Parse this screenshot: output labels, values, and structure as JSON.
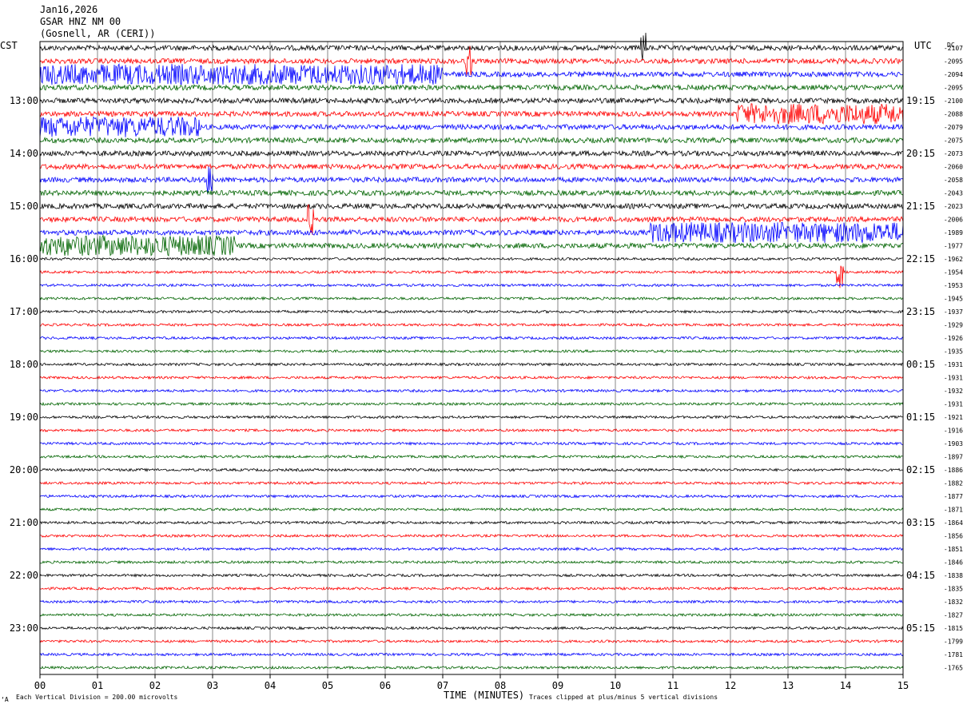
{
  "header": {
    "date": "Jan16,2026",
    "station": "GSAR HNZ NM 00",
    "location": "(Gosnell, AR (CERI))"
  },
  "left_zone": "CST",
  "right_zone": "UTC",
  "dc_label": "DC",
  "footer": {
    "scale_note": "Each Vertical Division =  200.00 microvolts",
    "clip_note": "Traces clipped at plus/minus 5 vertical divisions",
    "corner_mark": "‘A"
  },
  "chart_data": {
    "type": "line",
    "title": "",
    "xlabel": "TIME (MINUTES)",
    "xlim": [
      0,
      15
    ],
    "x_ticks": [
      "00",
      "01",
      "02",
      "03",
      "04",
      "05",
      "06",
      "07",
      "08",
      "09",
      "10",
      "11",
      "12",
      "13",
      "14",
      "15"
    ],
    "trace_colors": [
      "#000000",
      "#ff0000",
      "#0000ff",
      "#006400"
    ],
    "left_hour_labels": [
      "13:00",
      "14:00",
      "15:00",
      "16:00",
      "17:00",
      "18:00",
      "19:00",
      "20:00",
      "21:00",
      "22:00",
      "23:00"
    ],
    "right_hour_labels": [
      "19:15",
      "20:15",
      "21:15",
      "22:15",
      "23:15",
      "00:15",
      "01:15",
      "02:15",
      "03:15",
      "04:15",
      "05:15"
    ],
    "dc_offsets": [
      -2107,
      -2095,
      -2094,
      -2095,
      -2100,
      -2088,
      -2079,
      -2075,
      -2073,
      -2060,
      -2058,
      -2043,
      -2023,
      -2006,
      -1989,
      -1977,
      -1962,
      -1954,
      -1953,
      -1945,
      -1937,
      -1929,
      -1926,
      -1935,
      -1931,
      -1931,
      -1932,
      -1931,
      -1921,
      -1916,
      -1903,
      -1897,
      -1886,
      -1882,
      -1877,
      -1871,
      -1864,
      -1856,
      -1851,
      -1846,
      -1838,
      -1835,
      -1832,
      -1827,
      -1815,
      -1799,
      -1781,
      -1765
    ],
    "noisy_segments": [
      {
        "trace": 2,
        "start_min": 0.0,
        "end_min": 7.0,
        "level": "high"
      },
      {
        "trace": 5,
        "start_min": 12.1,
        "end_min": 15.0,
        "level": "high"
      },
      {
        "trace": 6,
        "start_min": 0.0,
        "end_min": 2.8,
        "level": "high"
      },
      {
        "trace": 14,
        "start_min": 10.6,
        "end_min": 15.0,
        "level": "high"
      },
      {
        "trace": 15,
        "start_min": 0.0,
        "end_min": 3.4,
        "level": "high"
      }
    ],
    "spikes": [
      {
        "trace": 0,
        "minute": 10.5
      },
      {
        "trace": 1,
        "minute": 7.45
      },
      {
        "trace": 10,
        "minute": 2.95
      },
      {
        "trace": 13,
        "minute": 4.7
      },
      {
        "trace": 17,
        "minute": 13.9
      }
    ]
  }
}
